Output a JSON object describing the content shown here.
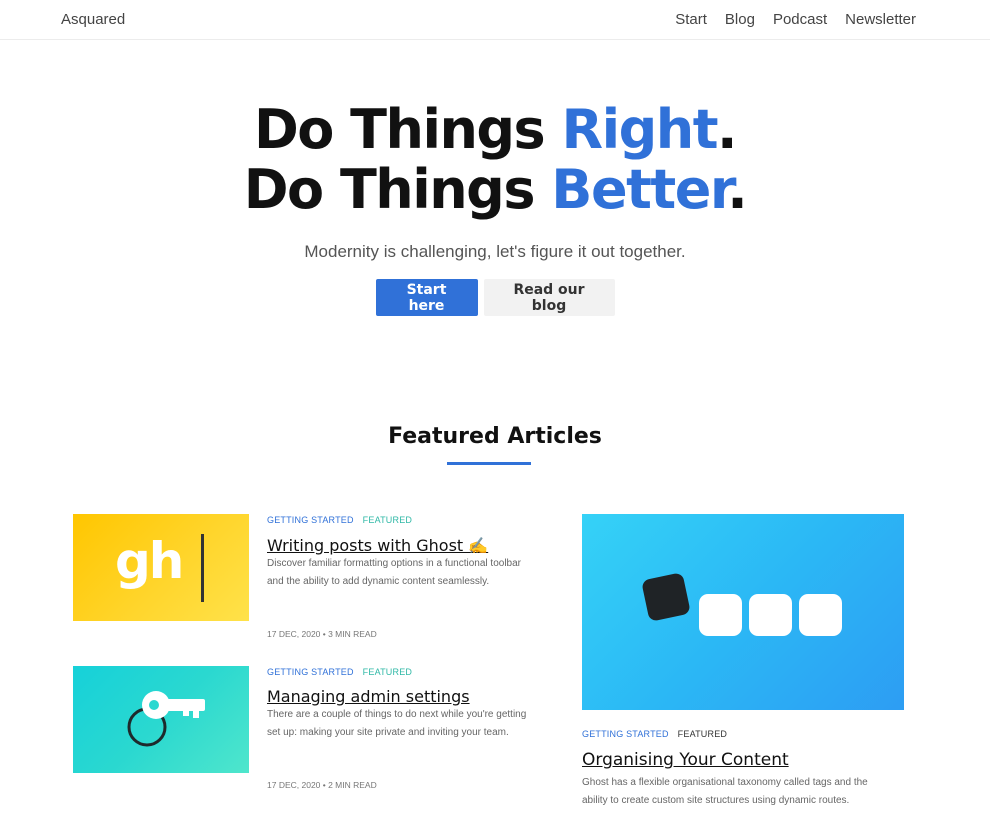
{
  "site": {
    "brand": "Asquared"
  },
  "nav": {
    "items": [
      {
        "label": "Start"
      },
      {
        "label": "Blog"
      },
      {
        "label": "Podcast"
      },
      {
        "label": "Newsletter"
      }
    ]
  },
  "hero": {
    "line1_main": "Do Things ",
    "line1_accent": "Right",
    "line1_end": ".",
    "line2_main": "Do Things ",
    "line2_accent": "Better",
    "line2_end": ".",
    "tagline": "Modernity is challenging, let's figure it out together.",
    "primary_label": "Start here",
    "secondary_label": "Read our blog"
  },
  "colors": {
    "accent": "#3071d8",
    "featured_tag": "#2fb8a6"
  },
  "featured": {
    "title": "Featured Articles",
    "articles": [
      {
        "tags": [
          "GETTING STARTED",
          "FEATURED"
        ],
        "title": "Writing posts with Ghost ✍️",
        "excerpt": "Discover familiar formatting options in a functional toolbar and the ability to add dynamic content seamlessly.",
        "meta": "17 DEC, 2020 • 3 MIN READ",
        "image_text": "gh"
      },
      {
        "tags": [
          "GETTING STARTED",
          "FEATURED"
        ],
        "title": "Managing admin settings",
        "excerpt": "There are a couple of things to do next while you're getting set up: making your site private and inviting your team.",
        "meta": "17 DEC, 2020 • 2 MIN READ"
      },
      {
        "tags": [
          "GETTING STARTED",
          "FEATURED"
        ],
        "title": "Organising Your Content",
        "excerpt": "Ghost has a flexible organisational taxonomy called tags and the ability to create custom site structures using dynamic routes."
      }
    ]
  }
}
